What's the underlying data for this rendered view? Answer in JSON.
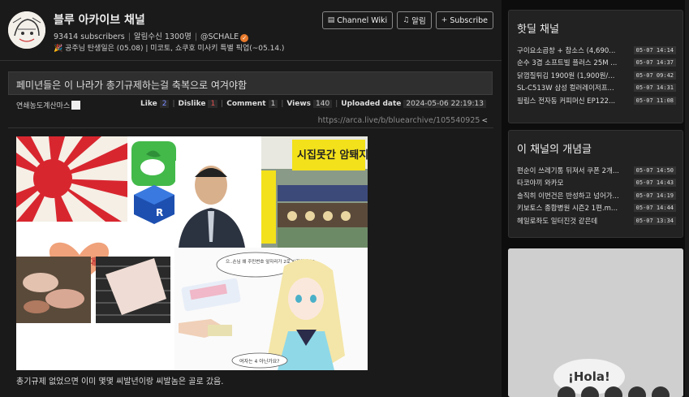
{
  "channel": {
    "title": "블루 아카이브 채널",
    "subscribers": "93414 subscribers",
    "notify_count": "알림수신 1300명",
    "owner": "@SCHALE",
    "notice": "🎉 공주님 탄생일은 (05.08) | 미코토, 쇼쿠호 미사키 특별 픽업(~05.14.)"
  },
  "buttons": {
    "wiki": "Channel Wiki",
    "alarm": "알림",
    "subscribe": "Subscribe"
  },
  "post": {
    "title": "페미년들은 이 나라가 총기규제하는걸 축복으로 여겨야함",
    "author": "연쇄농도계산마스",
    "like_label": "Like",
    "like_count": "2",
    "dislike_label": "Dislike",
    "dislike_count": "1",
    "comment_label": "Comment",
    "comment_count": "1",
    "views_label": "Views",
    "views_count": "140",
    "uploaded_label": "Uploaded date",
    "uploaded_value": "2024-05-06 22:19:13",
    "url": "https://arca.live/b/bluearchive/105540925",
    "body": "총기규제 없었으면 이미 몇몇 씨발년이랑 씨발놈은 골로 갔음.",
    "image_text": {
      "sign": "시집못간 암퇘지",
      "heart": "여성시대",
      "bubble1": "으..손님 왜 주민번호 앞자리가 2로 시작하세요?",
      "bubble2": "여자는 4 아닌가요?"
    }
  },
  "sidebar": {
    "hot_title": "핫딜 채널",
    "hot_items": [
      {
        "title": "구이요소곱창 + 참소스 (4,690...",
        "date": "05-07 14:14"
      },
      {
        "title": "순수 3겹 소프트빌 플러스 25M ...",
        "date": "05-07 14:37"
      },
      {
        "title": "닭껍질튀김 1900원 (1,900원/...",
        "date": "05-07 09:42"
      },
      {
        "title": "SL-C513W 삼성 컬러레이저프...",
        "date": "05-07 14:31"
      },
      {
        "title": "필립스 전자동 커피머신 EP122...",
        "date": "05-07 11:08"
      }
    ],
    "concept_title": "이 채널의 개념글",
    "concept_items": [
      {
        "title": "편순이 쓰레기통 뒤져서 쿠폰 2개...",
        "date": "05-07 14:50"
      },
      {
        "title": "타코야끼 와카모",
        "date": "05-07 14:43"
      },
      {
        "title": "솔직히 이번건은 반성하고 넘어가...",
        "date": "05-07 14:19"
      },
      {
        "title": "키보토스 종합병원 시즌2 1편.m...",
        "date": "05-07 14:44"
      },
      {
        "title": "헤일로좌도 일터진것 같은데",
        "date": "05-07 13:34"
      }
    ],
    "ad_text": "¡Hola!"
  }
}
